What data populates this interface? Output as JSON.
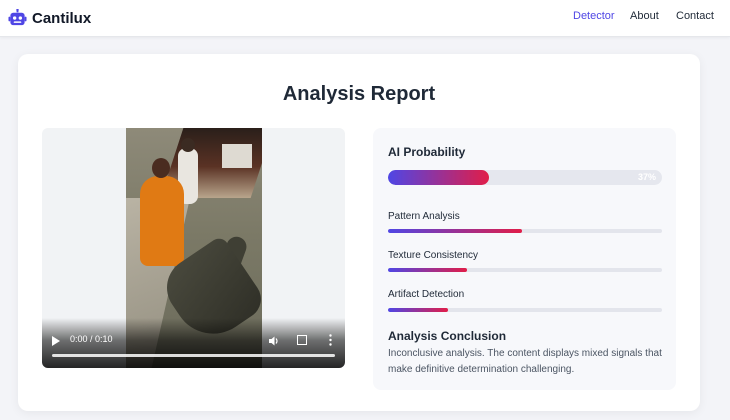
{
  "header": {
    "brand": "Cantilux",
    "nav": [
      {
        "label": "Detector",
        "active": true
      },
      {
        "label": "About",
        "active": false
      },
      {
        "label": "Contact",
        "active": false
      }
    ],
    "accent_color": "#4f46e5"
  },
  "report": {
    "title": "Analysis Report"
  },
  "video": {
    "time": "0:00 / 0:10",
    "progress": 0.0,
    "icons": [
      "play-icon",
      "volume-icon",
      "fullscreen-icon",
      "more-options-icon"
    ]
  },
  "analysis": {
    "ai_probability_title": "AI Probability",
    "ai_probability_value": 0.37,
    "ai_probability_text": "37%",
    "metrics": [
      {
        "label": "Pattern Analysis",
        "value": 0.49
      },
      {
        "label": "Texture Consistency",
        "value": 0.29
      },
      {
        "label": "Artifact Detection",
        "value": 0.22
      }
    ],
    "conclusion_title": "Analysis Conclusion",
    "conclusion_text": "Inconclusive analysis. The content displays mixed signals that make definitive determination challenging.",
    "gradient_start": "#4f46e5",
    "gradient_end": "#e11d48"
  }
}
